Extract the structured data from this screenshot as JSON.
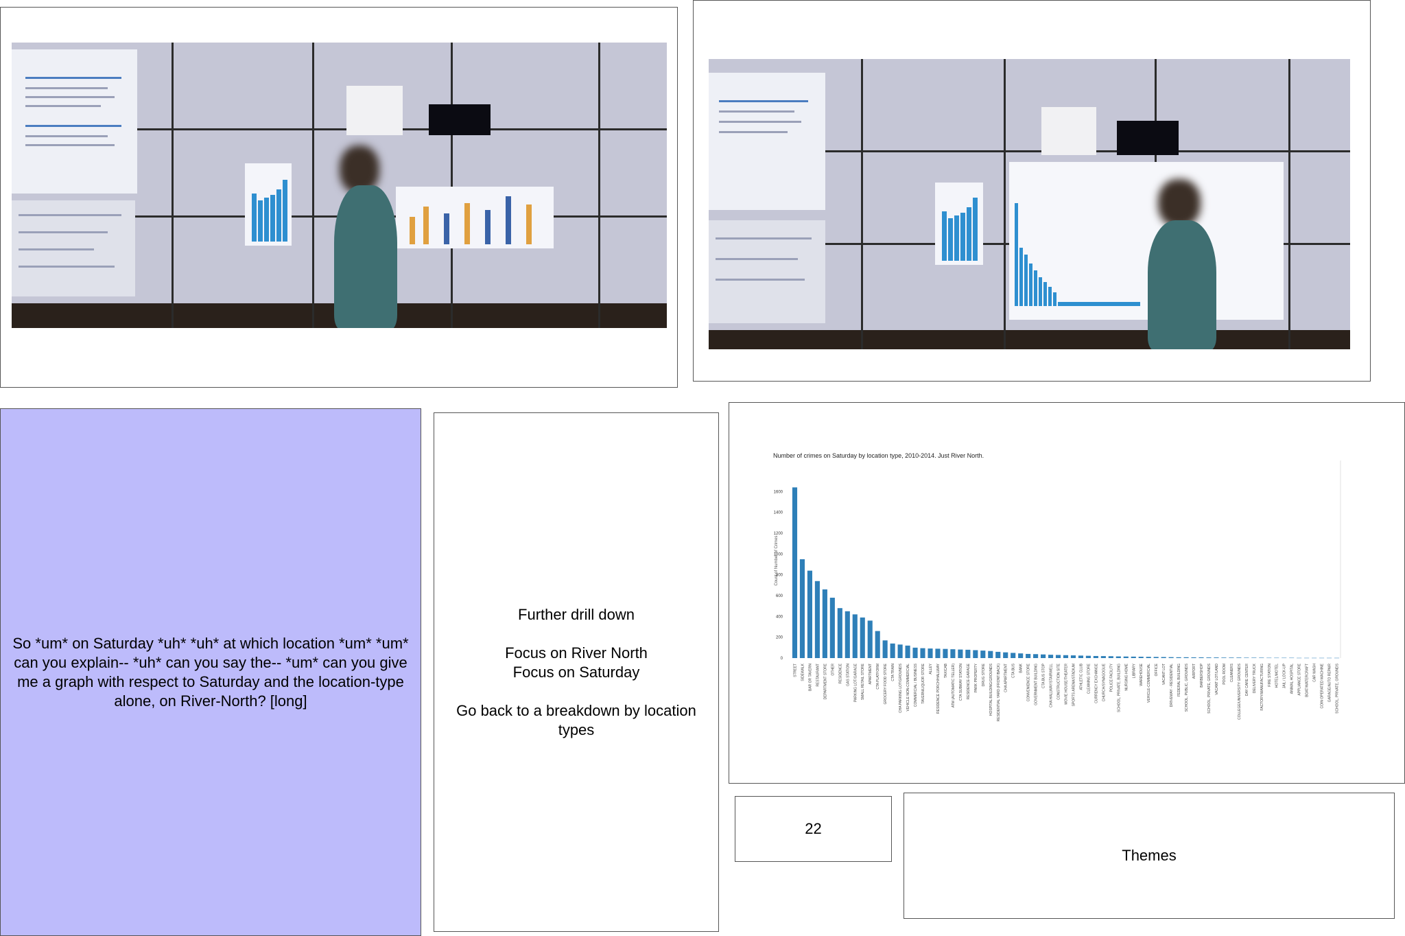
{
  "transcript": "So *um* on Saturday *uh* *uh* at which location *um* *um* can you explain-- *uh* can you say the-- *um* can you give me a graph with respect to Saturday and the location-type alone, on River-North? [long]",
  "notes": {
    "line1": "Further drill down",
    "line2": "Focus on River North",
    "line3": "Focus on Saturday",
    "line4": "Go back to a breakdown by location types"
  },
  "counter": "22",
  "themes_label": "Themes",
  "colors": {
    "bar": "#2e7fb8",
    "card_purple": "#bdbbfb"
  },
  "chart_data": {
    "type": "bar",
    "title": "Number of crimes on Saturday by location type, 2010-2014.  Just River North.",
    "ylabel": "Count of Number of Crimes",
    "xlabel": "",
    "ylim": [
      0,
      1800
    ],
    "yticks": [
      0,
      200,
      400,
      600,
      800,
      1000,
      1200,
      1400,
      1600
    ],
    "categories": [
      "STREET",
      "SIDEWALK",
      "BAR OR TAVERN",
      "RESTAURANT",
      "DEPARTMENT STORE",
      "OTHER",
      "RESIDENCE",
      "GAS STATION",
      "PARKING LOT/GARAGE",
      "SMALL RETAIL STORE",
      "APARTMENT",
      "CTA PLATFORM",
      "GROCERY FOOD STORE",
      "CTA TRAIN",
      "CHA PARKING LOT/GROUNDS",
      "VEHICLE NON-COMMERCIAL",
      "COMMERCIAL / BUSINESS",
      "TAVERN/LIQUOR STORE",
      "ALLEY",
      "RESIDENCE PORCH/HALLWAY",
      "TAXICAB",
      "ATM (AUTOMATIC TELLER)",
      "CTA SUBWAY STATION",
      "RESIDENCE-GARAGE",
      "PARK PROPERTY",
      "DRUG STORE",
      "HOSPITAL BUILDING/GROUNDS",
      "RESIDENTIAL YARD (FRONT/BACK)",
      "CHA APARTMENT",
      "CTA BUS",
      "BANK",
      "CONVENIENCE STORE",
      "GOVERNMENT BUILDING",
      "CTA BUS STOP",
      "CHA HALLWAY/STAIRWELL",
      "CONSTRUCTION SITE",
      "MOVIE HOUSE/THEATER",
      "SPORTS ARENA/STADIUM",
      "ATHLETIC CLUB",
      "CLEANING STORE",
      "CURRENCY EXCHANGE",
      "CHURCH/SYNAGOGUE",
      "POLICE FACILITY",
      "SCHOOL, PRIVATE, BUILDING",
      "NURSING HOME",
      "LIBRARY",
      "WAREHOUSE",
      "VEHICLE-COMMERCIAL",
      "OFFICE",
      "VACANT LOT",
      "DRIVEWAY - RESIDENTIAL",
      "FEDERAL BUILDING",
      "SCHOOL, PUBLIC, GROUNDS",
      "AIRPORT",
      "BARBERSHOP",
      "SCHOOL, PRIVATE, GROUNDS",
      "VACANT LOT/LAND",
      "POOL ROOM",
      "CLEANERS",
      "COLLEGE/UNIVERSITY GROUNDS",
      "DAY CARE CENTER",
      "DELIVERY TRUCK",
      "FACTORY/MANUFACTURING",
      "FIRE STATION",
      "HOTEL/MOTEL",
      "JAIL / LOCK-UP",
      "ANIMAL HOSPITAL",
      "APPLIANCE STORE",
      "BOAT/WATERCRAFT",
      "CAR WASH",
      "COIN OPERATED MACHINE",
      "GARAGE/AUTO REPAIR",
      "SCHOOL, PRIVATE, GROUNDS"
    ],
    "values": [
      1640,
      950,
      840,
      740,
      660,
      580,
      480,
      450,
      420,
      390,
      360,
      260,
      170,
      140,
      130,
      120,
      100,
      95,
      92,
      90,
      88,
      85,
      82,
      80,
      76,
      72,
      68,
      60,
      55,
      50,
      45,
      40,
      38,
      35,
      32,
      30,
      28,
      26,
      24,
      22,
      20,
      19,
      18,
      16,
      15,
      14,
      13,
      12,
      11,
      10,
      9,
      8,
      8,
      7,
      7,
      6,
      6,
      5,
      5,
      5,
      4,
      4,
      4,
      3,
      3,
      3,
      3,
      2,
      2,
      2,
      2,
      2,
      2
    ]
  }
}
